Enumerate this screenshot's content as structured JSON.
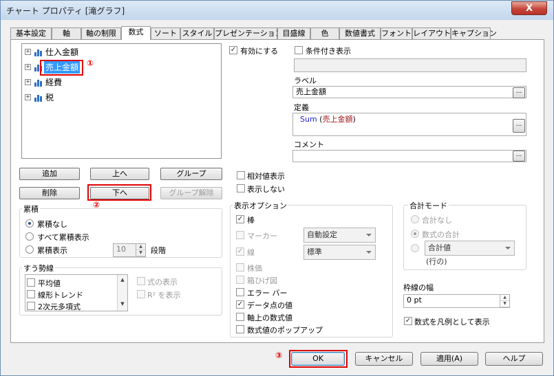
{
  "window": {
    "title": "チャート プロパティ [滝グラフ]",
    "close_label": "X"
  },
  "tabs": [
    "基本設定",
    "軸",
    "軸の制限",
    "数式",
    "ソート",
    "スタイル",
    "プレゼンテーション",
    "目盛線",
    "色",
    "数値書式",
    "フォント",
    "レイアウト",
    "キャプション"
  ],
  "active_tab": "数式",
  "expressions": [
    {
      "label": "仕入金額",
      "selected": false
    },
    {
      "label": "売上金額",
      "selected": true
    },
    {
      "label": "経費",
      "selected": false
    },
    {
      "label": "税",
      "selected": false
    }
  ],
  "annotations": {
    "mark1": "①",
    "mark2": "②",
    "mark3": "③"
  },
  "buttons": {
    "add": "追加",
    "up": "上へ",
    "group": "グループ",
    "delete": "削除",
    "down": "下へ",
    "ungroup": "グループ解除"
  },
  "accumulation": {
    "title": "累積",
    "none": "累積なし",
    "all": "すべて累積表示",
    "show": "累積表示",
    "steps_value": "10",
    "steps_label": "段階",
    "selected": "none"
  },
  "trendlines": {
    "title": "すう勢線",
    "items": [
      "平均値",
      "線形トレンド",
      "2次元多項式"
    ],
    "show_equation": "式の表示",
    "show_r2": "R² を表示"
  },
  "right": {
    "enable": "有効にする",
    "conditional": "条件付き表示",
    "label_title": "ラベル",
    "label_value": "売上金額",
    "definition_title": "定義",
    "definition_func": "Sum",
    "definition_arg": "売上金額",
    "comment_title": "コメント",
    "comment_value": "",
    "ellipsis": "...",
    "relative": "相対値表示",
    "invisible": "表示しない"
  },
  "display_options": {
    "title": "表示オプション",
    "bar": "棒",
    "marker": "マーカー",
    "marker_combo": "自動設定",
    "line": "線",
    "line_combo": "標準",
    "candlestick": "株価",
    "boxplot": "箱ひげ図",
    "errorbar": "エラー バー",
    "values_on_points": "データ点の値",
    "text_on_axis": "軸上の数式値",
    "popup": "数式値のポップアップ"
  },
  "total_mode": {
    "title": "合計モード",
    "no_totals": "合計なし",
    "expr_total": "数式の合計",
    "combo_value": "合計値",
    "row_label": "(行の)"
  },
  "bar_border": {
    "title": "枠線の幅",
    "value": "0 pt"
  },
  "legend": "数式を凡例として表示",
  "footer": {
    "ok": "OK",
    "cancel": "キャンセル",
    "apply": "適用(A)",
    "help": "ヘルプ"
  }
}
